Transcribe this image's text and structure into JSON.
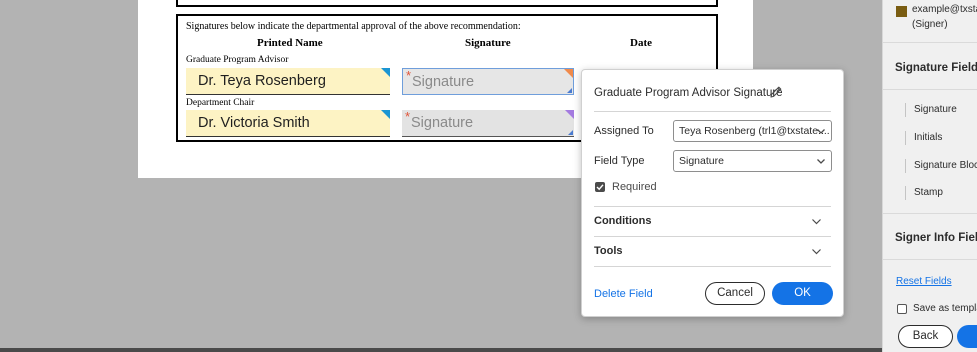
{
  "document": {
    "intro": "Signatures below indicate the departmental approval of the above recommendation:",
    "col_printed_name": "Printed Name",
    "col_signature": "Signature",
    "col_date": "Date",
    "rows": [
      {
        "role": "Graduate Program Advisor",
        "name": "Dr. Teya Rosenberg",
        "signature_placeholder": "Signature",
        "corner_color": "#f08a4b"
      },
      {
        "role": "Department Chair",
        "name": "Dr. Victoria Smith",
        "signature_placeholder": "Signature",
        "corner_color": "#a47be0"
      }
    ],
    "required_marker": "*"
  },
  "popup": {
    "title": "Graduate Program Advisor Signature",
    "assigned_to_label": "Assigned To",
    "assigned_to_value": "Teya Rosenberg (trl1@txstate....",
    "field_type_label": "Field Type",
    "field_type_value": "Signature",
    "required_label": "Required",
    "required_checked": true,
    "conditions_label": "Conditions",
    "tools_label": "Tools",
    "delete_label": "Delete Field",
    "cancel_label": "Cancel",
    "ok_label": "OK"
  },
  "panel": {
    "signer_email": "example@txstate.edu",
    "signer_role": "(Signer)",
    "signer_color": "#7a5d12",
    "signature_fields_heading": "Signature Fields",
    "field_types": [
      "Signature",
      "Initials",
      "Signature Block",
      "Stamp"
    ],
    "signer_info_heading": "Signer Info Fields",
    "reset_label": "Reset Fields",
    "save_template_label": "Save as template",
    "back_label": "Back"
  },
  "colors": {
    "accent": "#1473e6",
    "text_field_bg": "#fdf3c4",
    "text_field_corner": "#1b95d3",
    "required_star": "#e0553a"
  }
}
